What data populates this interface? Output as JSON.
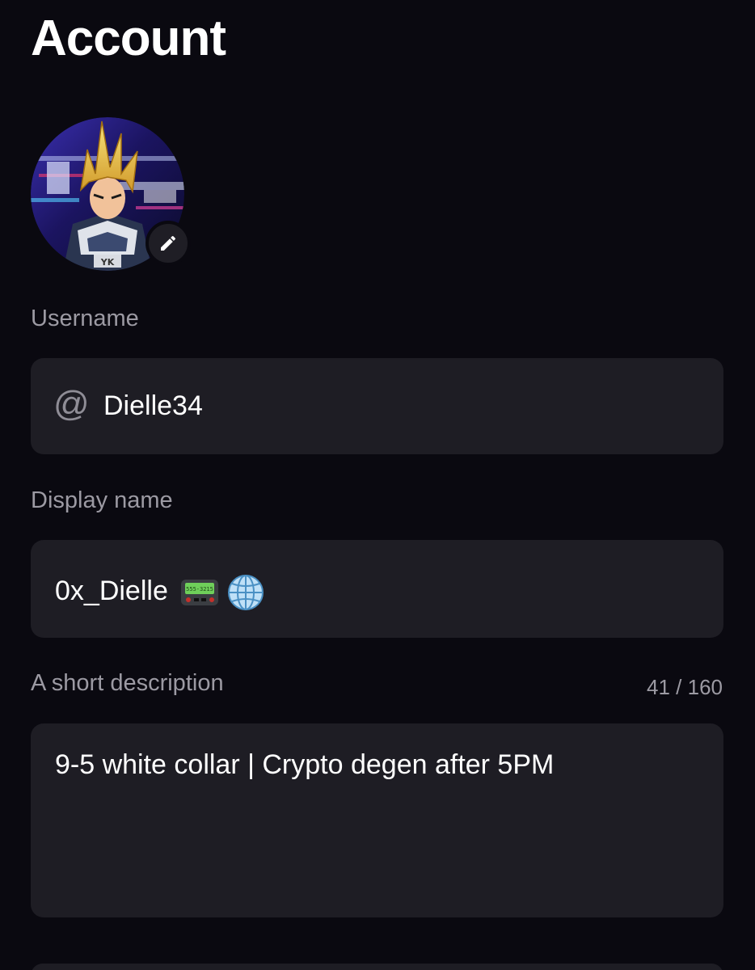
{
  "header": {
    "title": "Account"
  },
  "avatar": {
    "edit_icon": "pencil-icon"
  },
  "username": {
    "label": "Username",
    "prefix": "@",
    "value": "Dielle34"
  },
  "display_name": {
    "label": "Display name",
    "value": "0x_Dielle",
    "emoji_icons": [
      "pager-icon",
      "globe-icon"
    ]
  },
  "description": {
    "label": "A short description",
    "counter": "41 / 160",
    "value": "9-5 white collar | Crypto degen after 5PM"
  },
  "colors": {
    "background": "#0a0910",
    "field": "#1e1d24",
    "label": "#9c9aa3",
    "text": "#ffffff"
  }
}
